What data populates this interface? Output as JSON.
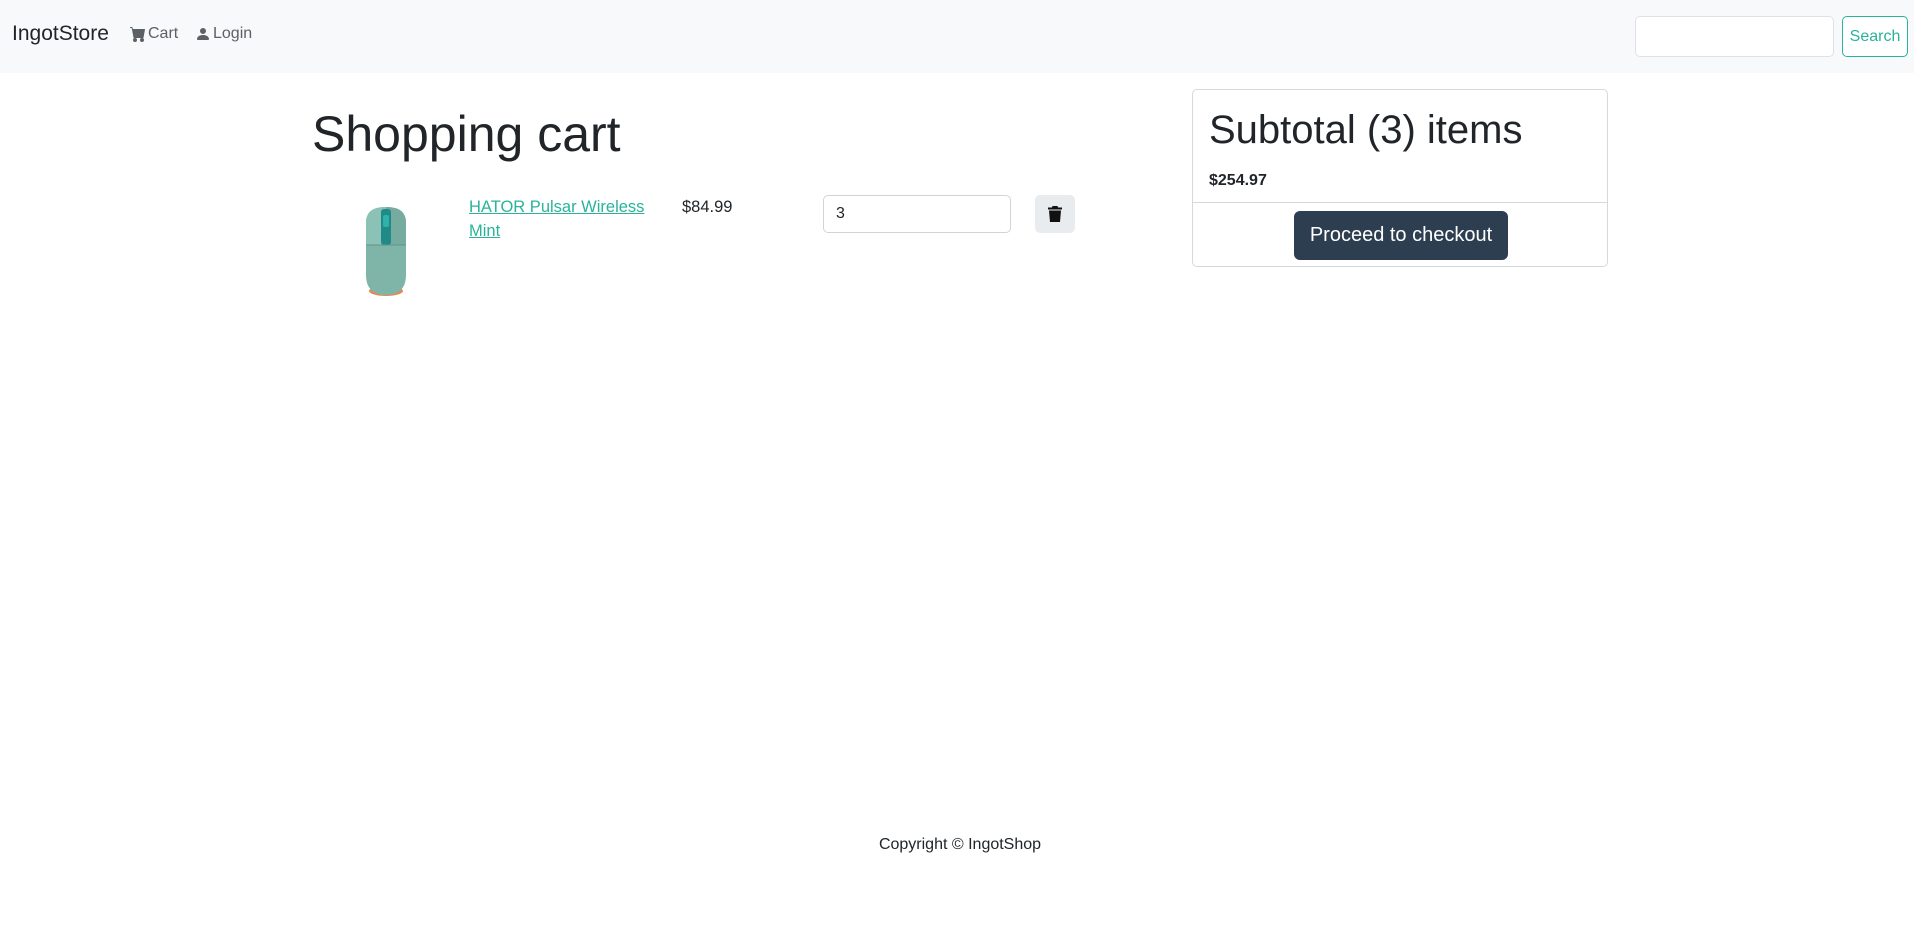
{
  "navbar": {
    "brand": "IngotStore",
    "cart_label": "Cart",
    "login_label": "Login",
    "search_placeholder": "",
    "search_button": "Search"
  },
  "main": {
    "title": "Shopping cart",
    "items": [
      {
        "name": "HATOR Pulsar Wireless Mint",
        "price": "$84.99",
        "quantity": "3",
        "image": "mint-wireless-mouse"
      }
    ]
  },
  "summary": {
    "title": "Subtotal (3) items",
    "total": "$254.97",
    "checkout_label": "Proceed to checkout"
  },
  "footer": {
    "text": "Copyright © IngotShop"
  },
  "colors": {
    "accent": "#2ab39a",
    "primary_dark": "#2c3e50",
    "navbar_bg": "#f8f9fa"
  },
  "icons": {
    "cart": "cart-icon",
    "user": "user-icon",
    "delete": "trash-icon"
  }
}
